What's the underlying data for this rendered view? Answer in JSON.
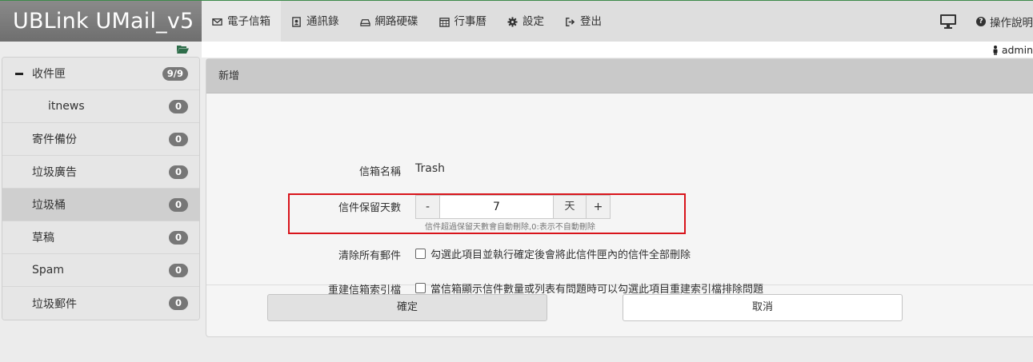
{
  "app": {
    "title": "UBLink UMail_v5"
  },
  "nav": [
    {
      "label": "電子信箱",
      "icon": "envelope-icon"
    },
    {
      "label": "通訊錄",
      "icon": "contacts-icon"
    },
    {
      "label": "網路硬碟",
      "icon": "drive-icon"
    },
    {
      "label": "行事曆",
      "icon": "calendar-icon"
    },
    {
      "label": "設定",
      "icon": "gear-icon"
    },
    {
      "label": "登出",
      "icon": "logout-icon"
    }
  ],
  "topright": {
    "help_label": "操作說明"
  },
  "user": {
    "name": "admin"
  },
  "sidebar": {
    "folders": [
      {
        "label": "收件匣",
        "count": "9/9"
      },
      {
        "label": "itnews",
        "count": "0"
      },
      {
        "label": "寄件備份",
        "count": "0"
      },
      {
        "label": "垃圾廣告",
        "count": "0"
      },
      {
        "label": "垃圾桶",
        "count": "0"
      },
      {
        "label": "草稿",
        "count": "0"
      },
      {
        "label": "Spam",
        "count": "0"
      },
      {
        "label": "垃圾郵件",
        "count": "0"
      }
    ]
  },
  "panel": {
    "title": "新增",
    "mailbox_name_label": "信箱名稱",
    "mailbox_name_value": "Trash",
    "retention_label": "信件保留天數",
    "retention_minus": "-",
    "retention_value": "7",
    "retention_unit": "天",
    "retention_plus": "+",
    "retention_hint": "信件超過保留天數會自動刪除,0:表示不自動刪除",
    "clear_label": "清除所有郵件",
    "clear_text": "勾選此項目並執行確定後會將此信件匣內的信件全部刪除",
    "rebuild_label": "重建信箱索引檔",
    "rebuild_text": "當信箱顯示信件數量或列表有問題時可以勾選此項目重建索引檔排除問題",
    "ok_label": "確定",
    "cancel_label": "取消"
  }
}
